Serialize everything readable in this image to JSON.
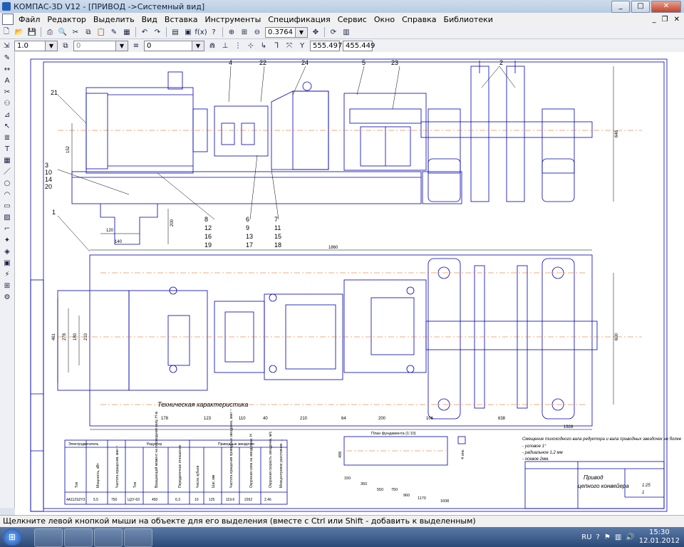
{
  "window": {
    "title": "КОМПАС-3D V12 - [ПРИВОД ->Системный вид]"
  },
  "menu": [
    "Файл",
    "Редактор",
    "Выделить",
    "Вид",
    "Вставка",
    "Инструменты",
    "Спецификация",
    "Сервис",
    "Окно",
    "Справка",
    "Библиотеки"
  ],
  "toolbar": {
    "zoom_value": "0.3764",
    "scale_value": "1.0",
    "layer_value": "0",
    "style_value": "0",
    "coord_x": "555.497",
    "coord_y": "455.449"
  },
  "drawing": {
    "part_labels": [
      "4",
      "22",
      "24",
      "5",
      "23",
      "2",
      "21",
      "3",
      "10",
      "14",
      "20",
      "1",
      "8",
      "12",
      "16",
      "19",
      "6",
      "9",
      "13",
      "17",
      "7",
      "11",
      "15",
      "18"
    ],
    "dims": {
      "d_152": "152",
      "d_120": "120",
      "d_140": "140",
      "d_200": "200",
      "d_1860": "1860",
      "d_648": "648",
      "d_600": "600",
      "bottom_dims": [
        "178",
        "123",
        "110",
        "40",
        "210",
        "64",
        "200",
        "106",
        "638"
      ],
      "d_1928": "1928",
      "left_dims": [
        "461",
        "278",
        "180",
        "210"
      ]
    },
    "tech_caption": "Техническая характеристика",
    "table": {
      "groups": [
        "Электродвигатель",
        "Редуктор",
        "Приводные звездочки"
      ],
      "headers": [
        "Тип",
        "Мощность, кВт",
        "Частота вращения, мин⁻¹",
        "Тип",
        "Вращающий момент на тихоходном валу, Н·м",
        "Передаточное отношение",
        "Число зубьев",
        "Шаг, мм",
        "Частота вращения приводных звездочек, мин⁻¹",
        "Окружная сила на звездочках, Н",
        "Окружная скорость звездочек, м/с",
        "Межцентровое расстояние ..."
      ],
      "row": [
        "4А112S2Y3",
        "5.5",
        "750",
        "Ц2У-63",
        "450",
        "6.3",
        "10",
        "125",
        "119.6",
        "2262",
        "2.46",
        ""
      ]
    },
    "plan_title": "План фундамента (1:10)",
    "plan_dims": {
      "d_150": "150",
      "d_350": "350",
      "d_550": "550",
      "d_750": "750",
      "d_960": "960",
      "d_1170": "1170",
      "d_1608": "1608",
      "d_498": "498",
      "hole": "4 отв."
    },
    "notes": [
      "Смещение тихоходного вала редуктора и вала приводных звездочек не более",
      "- угловое 1°",
      "- радиальное 1,2 мм",
      "- осевое 2мм."
    ],
    "stamp": {
      "title_line1": "Привод",
      "title_line2": "цепного конвейера",
      "scale": "1:25",
      "sheet": "1"
    }
  },
  "status": {
    "text": "Щелкните левой кнопкой мыши на объекте для его выделения (вместе с Ctrl или Shift - добавить к выделенным)"
  },
  "taskbar": {
    "lang": "RU",
    "time": "15:30",
    "date": "12.01.2012"
  },
  "colors": {
    "drawing_line": "#0000b0",
    "axis_line": "#e06000",
    "title_bar": "#b8cbe2"
  }
}
